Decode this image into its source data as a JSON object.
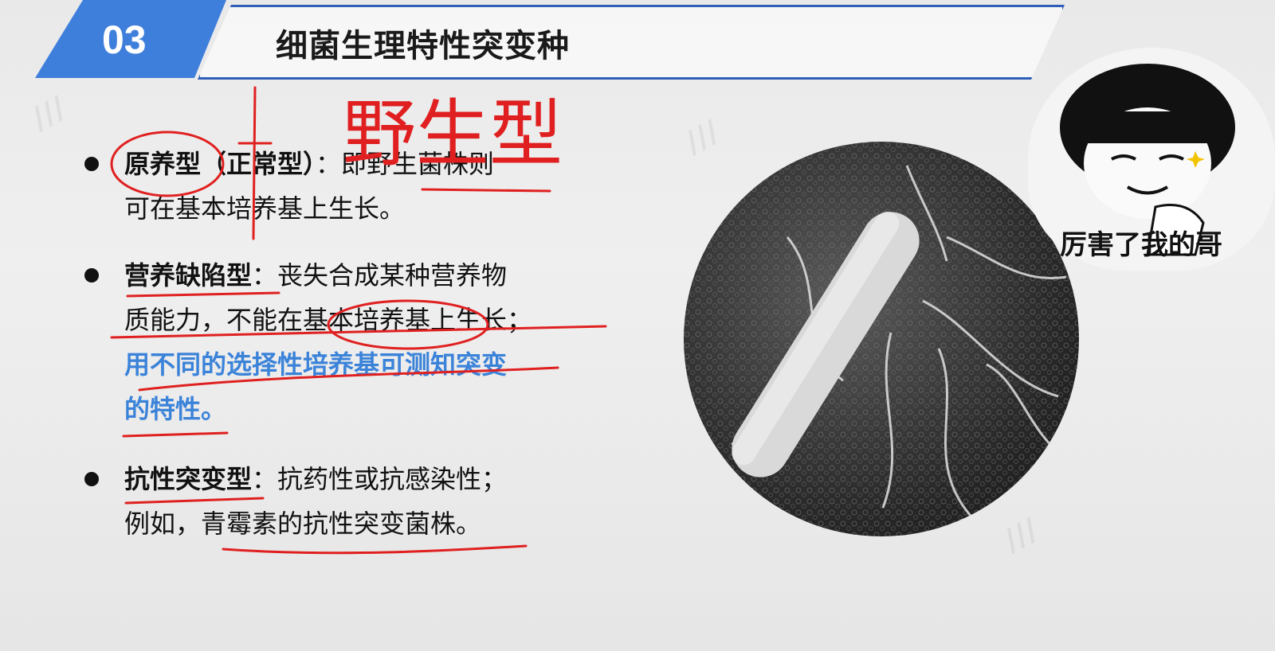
{
  "header": {
    "number": "03",
    "title": "细菌生理特性突变种"
  },
  "handwriting": "野生型",
  "bullets": [
    {
      "term": "原养型",
      "paren": "（正常型）",
      "sep": "：",
      "text": "即野生菌株则",
      "text2": "可在基本培养基上生长。"
    },
    {
      "term": "营养缺陷型",
      "sep": "：",
      "text": "丧失合成某种营养物",
      "text2": "质能力，不能在基本培养基上生长；",
      "highlight": "用不同的选择性培养基可测知突变",
      "highlight2": "的特性。"
    },
    {
      "term": "抗性突变型",
      "sep": "：",
      "text": "抗药性或抗感染性；",
      "text2": "例如，青霉素的抗性突变菌株。"
    }
  ],
  "meme": {
    "caption": "厉害了我的哥"
  },
  "colors": {
    "accent_blue": "#3f7fdc",
    "title_border": "#2f5fb8",
    "highlight_text": "#3b83d9",
    "annotation_red": "#e02020"
  }
}
